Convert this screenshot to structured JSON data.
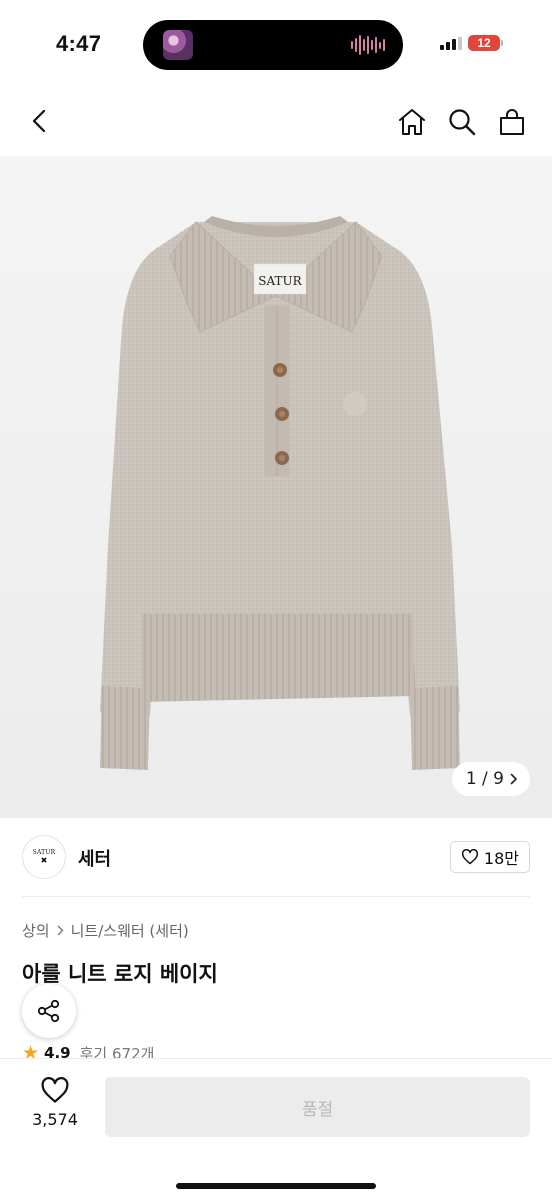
{
  "status_bar": {
    "time": "4:47",
    "battery": "12"
  },
  "nav": {
    "back_icon": "chevron-left-icon",
    "home_icon": "home-icon",
    "search_icon": "search-icon",
    "cart_icon": "shopping-bag-icon"
  },
  "product_image": {
    "label_text": "SATUR",
    "counter": "1 / 9"
  },
  "brand": {
    "logo_text": "SATUR",
    "name": "세터",
    "likes": "18만"
  },
  "breadcrumb": {
    "level1": "상의",
    "level2": "니트/스웨터 (세터)"
  },
  "product": {
    "title": "아를 니트 로지 베이지",
    "rating": "4.9",
    "review_label": "후기 672개"
  },
  "bottom_bar": {
    "wish_count": "3,574",
    "buy_label": "품절"
  },
  "colors": {
    "sweater": "#cbc4bc",
    "disabled_button": "#ececec",
    "star": "#f5a623",
    "battery_low": "#e0463c"
  }
}
